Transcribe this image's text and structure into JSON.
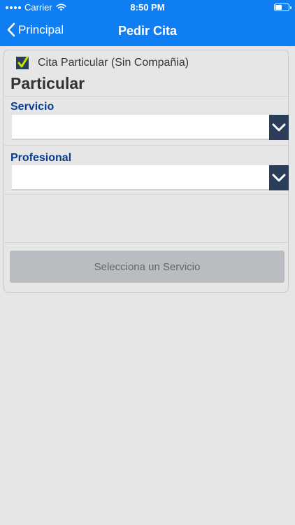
{
  "status_bar": {
    "carrier": "Carrier",
    "time": "8:50 PM"
  },
  "nav": {
    "back_label": "Principal",
    "title": "Pedir Cita"
  },
  "form": {
    "checkbox_label": "Cita Particular (Sin Compañia)",
    "checkbox_checked": true,
    "section_title": "Particular",
    "servicio_label": "Servicio",
    "servicio_value": "",
    "profesional_label": "Profesional",
    "profesional_value": "",
    "submit_label": "Selecciona un Servicio"
  },
  "colors": {
    "header": "#0f7ef2",
    "field_label": "#0a3d8f",
    "select_arrow": "#2a3e5a",
    "check_mark": "#c7e600",
    "button_disabled": "#b9bcc1"
  }
}
